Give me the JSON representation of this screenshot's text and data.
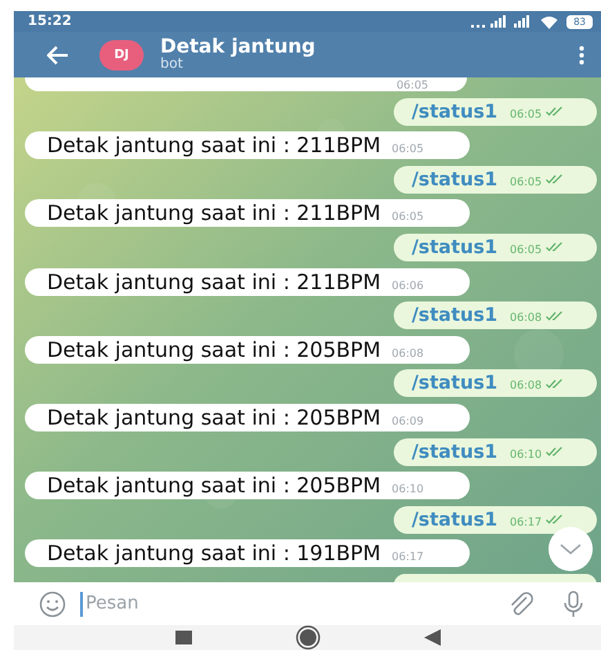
{
  "status_bar": {
    "time": "15:22",
    "battery": "83"
  },
  "header": {
    "avatar": "DJ",
    "title": "Detak jantung",
    "subtitle": "bot"
  },
  "messages": [
    {
      "kind": "incoming",
      "time": "06:05",
      "cut": true
    },
    {
      "kind": "outgoing",
      "text": "/status1",
      "time": "06:05",
      "read": true
    },
    {
      "kind": "incoming",
      "text": "Detak jantung saat ini : 211BPM",
      "time": "06:05"
    },
    {
      "kind": "outgoing",
      "text": "/status1",
      "time": "06:05",
      "read": true
    },
    {
      "kind": "incoming",
      "text": "Detak jantung saat ini : 211BPM",
      "time": "06:05"
    },
    {
      "kind": "outgoing",
      "text": "/status1",
      "time": "06:05",
      "read": true
    },
    {
      "kind": "incoming",
      "text": "Detak jantung saat ini : 211BPM",
      "time": "06:06"
    },
    {
      "kind": "outgoing",
      "text": "/status1",
      "time": "06:08",
      "read": true
    },
    {
      "kind": "incoming",
      "text": "Detak jantung saat ini : 205BPM",
      "time": "06:08"
    },
    {
      "kind": "outgoing",
      "text": "/status1",
      "time": "06:08",
      "read": true
    },
    {
      "kind": "incoming",
      "text": "Detak jantung saat ini : 205BPM",
      "time": "06:09"
    },
    {
      "kind": "outgoing",
      "text": "/status1",
      "time": "06:10",
      "read": true
    },
    {
      "kind": "incoming",
      "text": "Detak jantung saat ini : 205BPM",
      "time": "06:10"
    },
    {
      "kind": "outgoing",
      "text": "/status1",
      "time": "06:17",
      "read": true
    },
    {
      "kind": "incoming",
      "text": "Detak jantung saat ini : 191BPM",
      "time": "06:17"
    },
    {
      "kind": "outgoing",
      "cut": true
    }
  ],
  "composer": {
    "placeholder": "Pesan"
  }
}
